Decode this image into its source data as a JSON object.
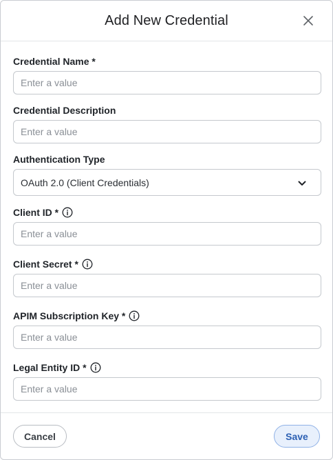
{
  "dialog": {
    "title": "Add New Credential",
    "close_icon": "close-icon"
  },
  "fields": {
    "credential_name": {
      "label": "Credential Name *",
      "placeholder": "Enter a value",
      "value": ""
    },
    "credential_description": {
      "label": "Credential Description",
      "placeholder": "Enter a value",
      "value": ""
    },
    "authentication_type": {
      "label": "Authentication Type",
      "selected": "OAuth 2.0 (Client Credentials)",
      "icon": "chevron-down-icon"
    },
    "client_id": {
      "label": "Client ID *",
      "placeholder": "Enter a value",
      "value": "",
      "icon": "info-icon"
    },
    "client_secret": {
      "label": "Client Secret *",
      "placeholder": "Enter a value",
      "value": "",
      "icon": "info-icon"
    },
    "apim_key": {
      "label": "APIM Subscription Key *",
      "placeholder": "Enter a value",
      "value": "",
      "icon": "info-icon"
    },
    "legal_entity_id": {
      "label": "Legal Entity ID *",
      "placeholder": "Enter a value",
      "value": "",
      "icon": "info-icon"
    }
  },
  "footer": {
    "cancel_label": "Cancel",
    "save_label": "Save"
  },
  "colors": {
    "save_accent": "#2b5fb3",
    "save_background": "#e8f0fc",
    "border": "#c4c8cd"
  }
}
